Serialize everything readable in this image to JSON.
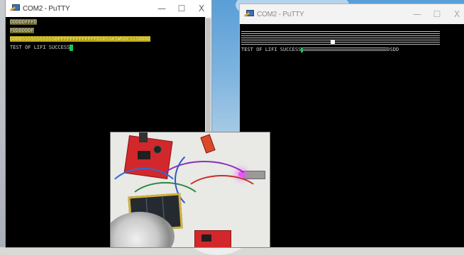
{
  "left_window": {
    "title": "COM2 - PuTTY",
    "controls": {
      "minimize": "—",
      "maximize": "☐",
      "close": "X"
    },
    "lines": [
      "DDDDDFFFD",
      "FDDDDDDF",
      "DDDDSSSSSSSSSSSDFFFFFFFFFFFFFDSDSSKSWSDCSSSDDDD",
      "TEST OF LIFI SUCCESS"
    ],
    "cursor_color": "#19c35b"
  },
  "right_window": {
    "title": "COM2 - PuTTY",
    "controls": {
      "minimize": "—",
      "maximize": "☐",
      "close": "X"
    },
    "status_line_prefix": "TEST OF LIFI SUCCESS",
    "status_line_suffix": "DSDD"
  },
  "photo": {
    "subject": "LiFi hardware setup",
    "icon": "circuit-board-photo"
  },
  "colors": {
    "terminal_bg": "#000000",
    "terminal_text": "#cfcfcf",
    "highlight": "#b9a400",
    "cursor": "#19c35b",
    "board": "#d2282b"
  }
}
